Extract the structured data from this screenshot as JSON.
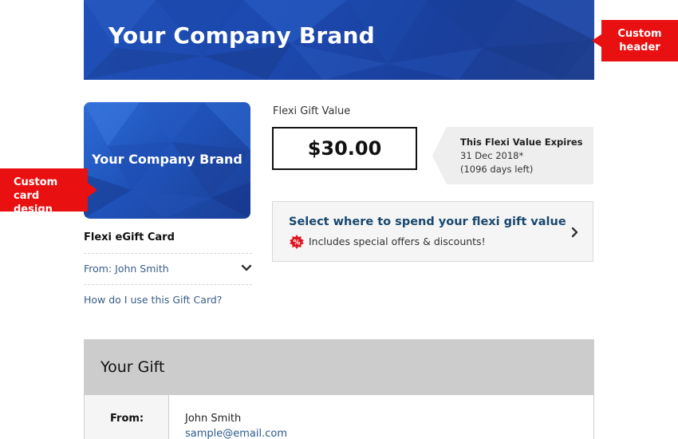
{
  "header": {
    "brand_title": "Your Company Brand",
    "background_color": "#1c48ad"
  },
  "callouts": {
    "header_label": "Custom header",
    "card_label": "Custom card design",
    "color": "#e81010"
  },
  "card": {
    "brand_title": "Your Company Brand",
    "name": "Flexi eGift Card",
    "from_label": "From: John Smith",
    "from_icon": "chevron-down-icon",
    "help_link": "How do I use this Gift Card?"
  },
  "value": {
    "label": "Flexi Gift Value",
    "amount": "$30.00",
    "expiry_title": "This Flexi Value Expires",
    "expiry_date": "31 Dec 2018*",
    "expiry_days": "(1096 days left)"
  },
  "spend": {
    "title": "Select where to spend your flexi gift value",
    "subtitle": "Includes special offers & discounts!",
    "badge_icon": "discount-badge-icon",
    "chevron_icon": "chevron-right-icon"
  },
  "gift": {
    "section_title": "Your Gift",
    "from_label": "From:",
    "from_name": "John Smith",
    "from_email": "sample@email.com"
  }
}
